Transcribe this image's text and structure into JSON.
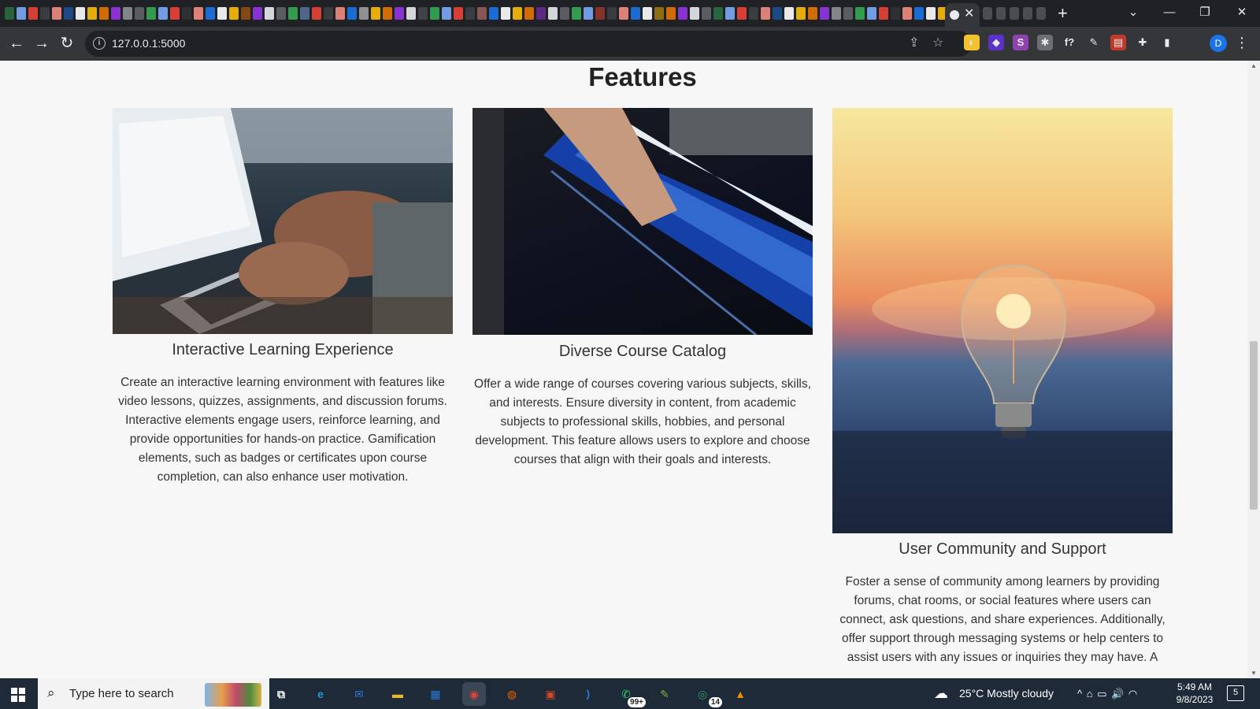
{
  "browser": {
    "tab_close_glyph": "✕",
    "new_tab_glyph": "+",
    "window_controls": {
      "menu": "⌄",
      "minimize": "—",
      "restore": "❐",
      "close": "✕"
    },
    "nav": {
      "back": "←",
      "forward": "→",
      "reload": "↻"
    },
    "address": "127.0.0.1:5000",
    "info_glyph": "i",
    "share_glyph": "⇪",
    "bookmark_glyph": "☆",
    "extensions": [
      {
        "name": "chrome-ext-icon",
        "glyph": "◐",
        "color": "#f2c230"
      },
      {
        "name": "hat-ext-icon",
        "glyph": "◆",
        "color": "#5a32c8"
      },
      {
        "name": "s-ext-icon",
        "glyph": "S",
        "color": "#8e44ad"
      },
      {
        "name": "gear-ext-icon",
        "glyph": "✱",
        "color": "#6b6f74"
      },
      {
        "name": "formula-ext-icon",
        "glyph": "f?",
        "color": "#35363a"
      },
      {
        "name": "pen-ext-icon",
        "glyph": "✎",
        "color": "#35363a"
      },
      {
        "name": "note-ext-icon",
        "glyph": "▤",
        "color": "#c0392b"
      },
      {
        "name": "puzzle-ext-icon",
        "glyph": "✚",
        "color": "#35363a"
      },
      {
        "name": "sidepanel-ext-icon",
        "glyph": "▮",
        "color": "#35363a"
      }
    ],
    "profile_initial": "D",
    "menu_glyph": "⋮"
  },
  "page": {
    "heading": "Features",
    "cards": [
      {
        "title": "Interactive Learning Experience",
        "body": "Create an interactive learning environment with features like video lessons, quizzes, assignments, and discussion forums. Interactive elements engage users, reinforce learning, and provide opportunities for hands-on practice. Gamification elements, such as badges or certificates upon course completion, can also enhance user motivation."
      },
      {
        "title": "Diverse Course Catalog",
        "body": "Offer a wide range of courses covering various subjects, skills, and interests. Ensure diversity in content, from academic subjects to professional skills, hobbies, and personal development. This feature allows users to explore and choose courses that align with their goals and interests."
      },
      {
        "title": "User Community and Support",
        "body": "Foster a sense of community among learners by providing forums, chat rooms, or social features where users can connect, ask questions, and share experiences. Additionally, offer support through messaging systems or help centers to assist users with any issues or inquiries they may have. A"
      }
    ]
  },
  "taskbar": {
    "search_placeholder": "Type here to search",
    "search_glyph": "⌕",
    "apps": [
      {
        "name": "task-view-icon",
        "glyph": "⧉",
        "color": "#1f2a38"
      },
      {
        "name": "edge-icon",
        "glyph": "e",
        "color": "#1aa0c8"
      },
      {
        "name": "mail-icon",
        "glyph": "✉",
        "color": "#2a7bd6"
      },
      {
        "name": "file-explorer-icon",
        "glyph": "▬",
        "color": "#e8b730"
      },
      {
        "name": "store-icon",
        "glyph": "▦",
        "color": "#2a7bd6"
      },
      {
        "name": "chrome-icon",
        "glyph": "◉",
        "color": "#db4437"
      },
      {
        "name": "firefox-icon",
        "glyph": "◍",
        "color": "#e66000"
      },
      {
        "name": "office-icon",
        "glyph": "▣",
        "color": "#d24726"
      },
      {
        "name": "vscode-icon",
        "glyph": "⟩",
        "color": "#2a7bd6"
      },
      {
        "name": "whatsapp-icon",
        "glyph": "✆",
        "color": "#25d366",
        "badge": "99+"
      },
      {
        "name": "notepad-icon",
        "glyph": "✎",
        "color": "#7cb342"
      },
      {
        "name": "app-icon",
        "glyph": "◎",
        "color": "#2e9c6a",
        "badge": "14"
      },
      {
        "name": "vlc-icon",
        "glyph": "▲",
        "color": "#f08a00"
      }
    ],
    "weather": "25°C  Mostly cloudy",
    "tray_glyphs": "^  ⌂  ▭  🔊  ◠",
    "time": "5:49 AM",
    "date": "9/8/2023",
    "notifications": "5"
  }
}
